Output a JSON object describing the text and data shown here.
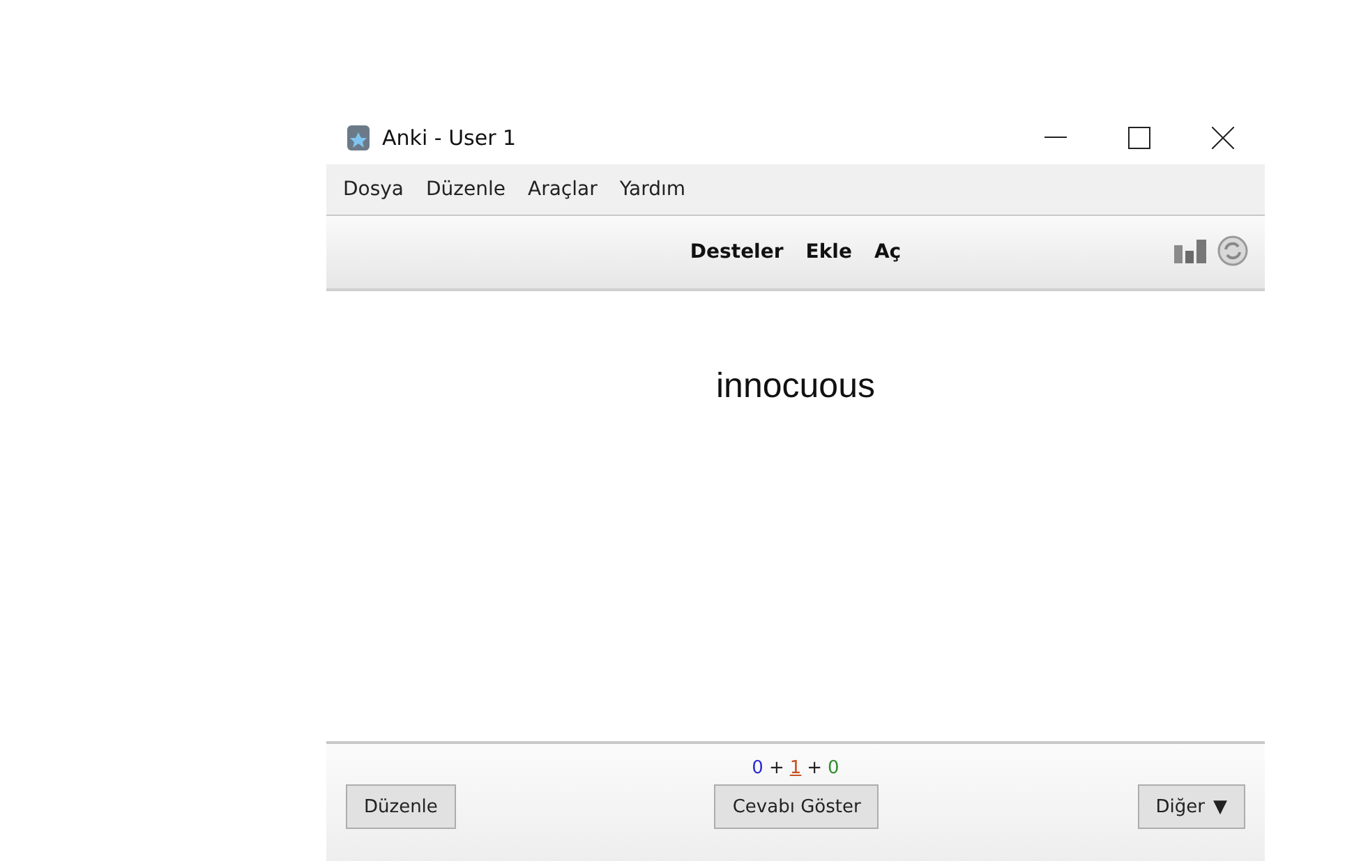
{
  "window": {
    "title": "Anki - User 1"
  },
  "menu": [
    "Dosya",
    "Düzenle",
    "Araçlar",
    "Yardım"
  ],
  "toolbar": {
    "links": [
      "Desteler",
      "Ekle",
      "Aç"
    ]
  },
  "card": {
    "question": "innocuous"
  },
  "counts": [
    {
      "kind": "count",
      "text": "0",
      "color": "#2b2bd0",
      "selected": false
    },
    {
      "kind": "plus",
      "text": "+"
    },
    {
      "kind": "count",
      "text": "1",
      "color": "#c8501e",
      "selected": true
    },
    {
      "kind": "plus",
      "text": "+"
    },
    {
      "kind": "count",
      "text": "0",
      "color": "#2f8f2f",
      "selected": false
    }
  ],
  "buttons": {
    "left": "Düzenle",
    "center": "Cevabı Göster",
    "right": "Diğer",
    "right_glyph": "▼"
  }
}
